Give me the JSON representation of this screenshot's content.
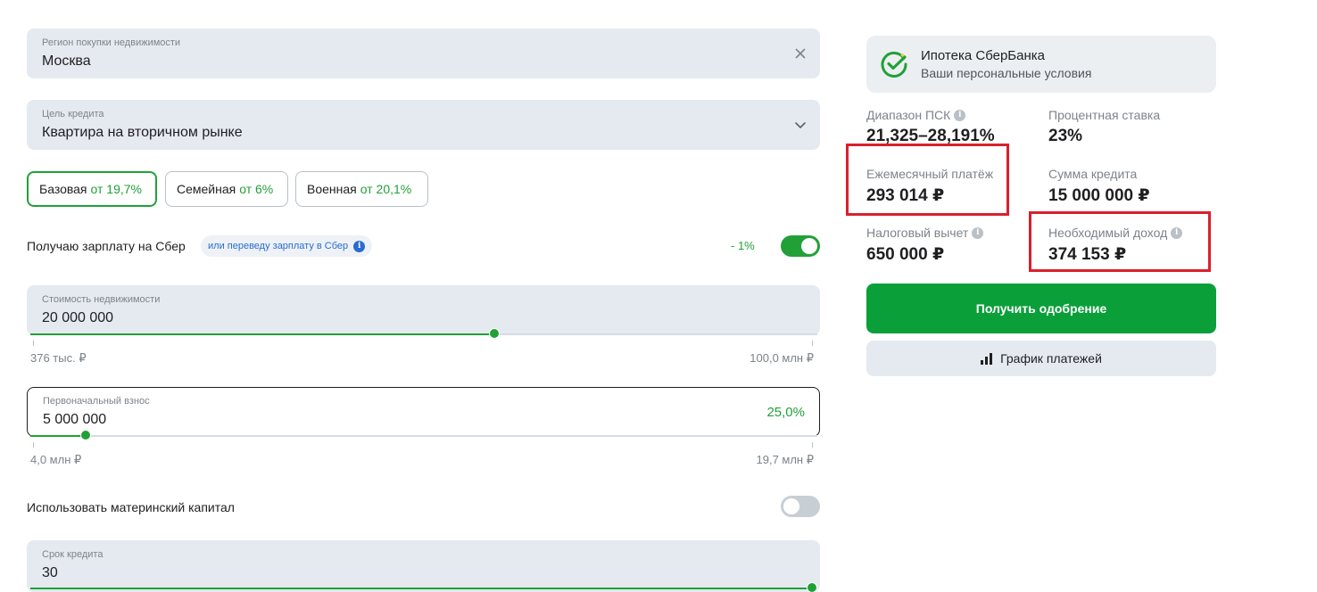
{
  "region": {
    "label": "Регион покупки недвижимости",
    "value": "Москва"
  },
  "goal": {
    "label": "Цель кредита",
    "value": "Квартира на вторичном рынке"
  },
  "programs": [
    {
      "name": "Базовая",
      "rate": "от 19,7%",
      "active": true
    },
    {
      "name": "Семейная",
      "rate": "от 6%",
      "active": false
    },
    {
      "name": "Военная",
      "rate": "от 20,1%",
      "active": false
    }
  ],
  "salary": {
    "label": "Получаю зарплату на Сбер",
    "pill": "или переведу зарплату в Сбер",
    "discount": "- 1%",
    "enabled": true
  },
  "property": {
    "label": "Стоимость недвижимости",
    "value": "20 000 000",
    "min": "376 тыс. ₽",
    "max": "100,0 млн ₽",
    "position": 0.59
  },
  "down": {
    "label": "Первоначальный взнос",
    "value": "5 000 000",
    "percent": "25,0%",
    "min": "4,0 млн ₽",
    "max": "19,7 млн ₽",
    "position": 0.07
  },
  "matcap": {
    "label": "Использовать материнский капитал",
    "enabled": false
  },
  "term": {
    "label": "Срок кредита",
    "value": "30",
    "position": 1.0
  },
  "offer": {
    "title": "Ипотека СберБанка",
    "subtitle": "Ваши персональные условия"
  },
  "metrics": {
    "psk": {
      "label": "Диапазон ПСК",
      "value": "21,325–28,191%"
    },
    "rate": {
      "label": "Процентная ставка",
      "value": "23%"
    },
    "monthly": {
      "label": "Ежемесячный платёж",
      "value": "293 014 ₽"
    },
    "amount": {
      "label": "Сумма кредита",
      "value": "15 000 000 ₽"
    },
    "tax": {
      "label": "Налоговый вычет",
      "value": "650 000 ₽"
    },
    "income": {
      "label": "Необходимый доход",
      "value": "374 153 ₽"
    }
  },
  "actions": {
    "approve": "Получить одобрение",
    "schedule": "График платежей"
  },
  "icons": {
    "clear": "close-icon",
    "dropdown": "chevron-down-icon",
    "info": "info-icon",
    "chart": "bar-chart-icon",
    "logo": "sber-logo-icon"
  },
  "colors": {
    "accent": "#21a038",
    "button": "#0b9f3a",
    "highlight": "#d9202c",
    "link": "#2a6bd1"
  }
}
